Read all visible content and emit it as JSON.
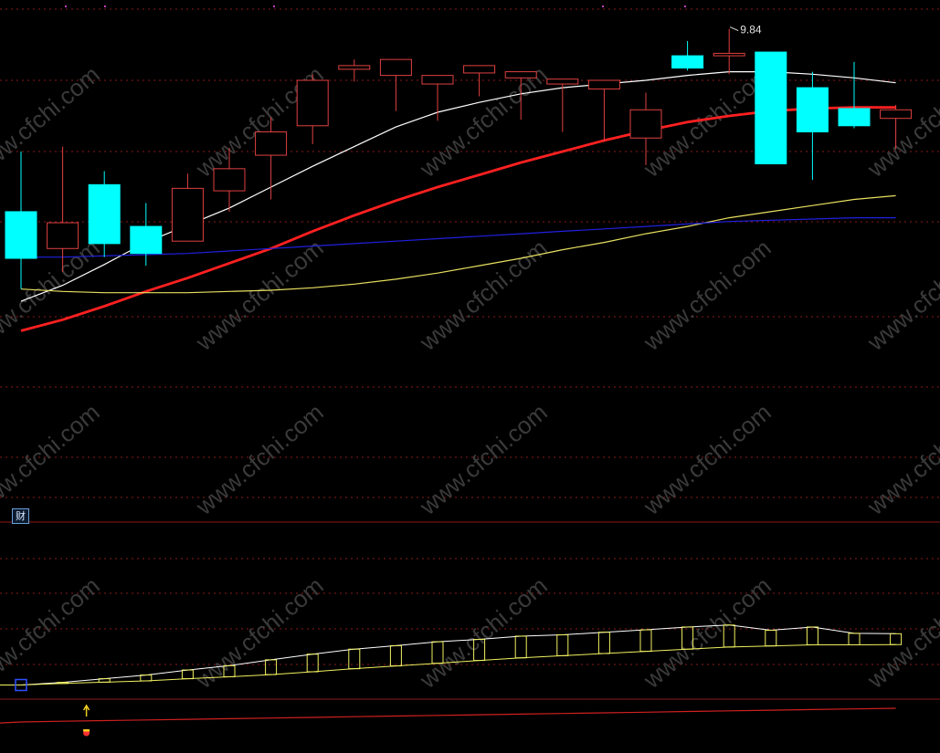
{
  "colors": {
    "background": "#000000",
    "up_candle": "#e04040",
    "down_candle": "#00ffff",
    "ma_white": "#ffffff",
    "ma_red": "#ff2020",
    "ma_yellow": "#e8e060",
    "ma_blue": "#2020e0",
    "grid": "#8b1a1a",
    "indicator_line": "#f0f060",
    "indicator_base": "#d02020"
  },
  "indicator_panel": {
    "badge_label": "财",
    "arrow_icon": "up-arrow-icon"
  },
  "chart_data": [
    {
      "type": "candlestick",
      "title": "",
      "xlabel": "",
      "ylabel": "",
      "annotations": [
        {
          "text": "9.84",
          "bar_index": 17
        }
      ],
      "grid": true,
      "ylim": [
        6.0,
        10.0
      ],
      "candles": [
        {
          "open": 8.35,
          "high": 8.84,
          "low": 7.72,
          "close": 7.97
        },
        {
          "open": 8.05,
          "high": 8.88,
          "low": 7.86,
          "close": 8.26
        },
        {
          "open": 8.57,
          "high": 8.68,
          "low": 7.98,
          "close": 8.09
        },
        {
          "open": 8.23,
          "high": 8.42,
          "low": 7.91,
          "close": 8.01
        },
        {
          "open": 8.11,
          "high": 8.66,
          "low": 8.11,
          "close": 8.54
        },
        {
          "open": 8.52,
          "high": 8.87,
          "low": 8.35,
          "close": 8.7
        },
        {
          "open": 8.81,
          "high": 9.12,
          "low": 8.45,
          "close": 9.0
        },
        {
          "open": 9.05,
          "high": 9.47,
          "low": 8.9,
          "close": 9.42
        },
        {
          "open": 9.51,
          "high": 9.59,
          "low": 9.41,
          "close": 9.54
        },
        {
          "open": 9.46,
          "high": 9.34,
          "low": 9.17,
          "close": 9.59
        },
        {
          "open": 9.39,
          "high": 9.23,
          "low": 9.09,
          "close": 9.46
        },
        {
          "open": 9.48,
          "high": 9.36,
          "low": 9.29,
          "close": 9.54
        },
        {
          "open": 9.44,
          "high": 9.21,
          "low": 9.1,
          "close": 9.49
        },
        {
          "open": 9.39,
          "high": 9.28,
          "low": 9.0,
          "close": 9.43
        },
        {
          "open": 9.35,
          "high": 9.04,
          "low": 8.92,
          "close": 9.42
        },
        {
          "open": 8.95,
          "high": 9.32,
          "low": 8.73,
          "close": 9.18
        },
        {
          "open": 9.62,
          "high": 9.74,
          "low": 9.5,
          "close": 9.52
        },
        {
          "open": 9.62,
          "high": 9.84,
          "low": 9.47,
          "close": 9.64
        },
        {
          "open": 9.65,
          "high": 9.65,
          "low": 8.83,
          "close": 8.74
        },
        {
          "open": 9.36,
          "high": 9.49,
          "low": 8.61,
          "close": 9.0
        },
        {
          "open": 9.19,
          "high": 9.57,
          "low": 9.03,
          "close": 9.05
        },
        {
          "open": 9.11,
          "high": 9.22,
          "low": 8.86,
          "close": 9.18
        }
      ],
      "series": [
        {
          "values": [
            7.62,
            7.75,
            7.92,
            8.1,
            8.24,
            8.38,
            8.55,
            8.72,
            8.88,
            9.04,
            9.16,
            9.24,
            9.31,
            9.36,
            9.39,
            9.42,
            9.46,
            9.49,
            9.49,
            9.47,
            9.44,
            9.4
          ]
        },
        {
          "values": [
            7.38,
            7.47,
            7.58,
            7.7,
            7.81,
            7.93,
            8.05,
            8.19,
            8.32,
            8.44,
            8.55,
            8.65,
            8.75,
            8.84,
            8.93,
            9.01,
            9.08,
            9.13,
            9.17,
            9.19,
            9.2,
            9.2
          ]
        },
        {
          "values": [
            7.72,
            7.7,
            7.69,
            7.69,
            7.69,
            7.7,
            7.71,
            7.73,
            7.76,
            7.8,
            7.85,
            7.91,
            7.97,
            8.04,
            8.1,
            8.17,
            8.23,
            8.3,
            8.35,
            8.4,
            8.45,
            8.48
          ]
        },
        {
          "values": [
            7.98,
            7.98,
            7.99,
            8.0,
            8.01,
            8.03,
            8.05,
            8.07,
            8.09,
            8.11,
            8.13,
            8.15,
            8.17,
            8.19,
            8.21,
            8.23,
            8.25,
            8.27,
            8.28,
            8.29,
            8.3,
            8.3
          ]
        }
      ]
    },
    {
      "type": "area",
      "title": "",
      "xlabel": "",
      "ylabel": "",
      "grid": true,
      "ylim": [
        0,
        100
      ],
      "marker_bar_index": 1,
      "series": [
        {
          "values": [
            25.0,
            26.2,
            27.9,
            29.6,
            31.9,
            33.9,
            36.6,
            39.2,
            41.5,
            43.1,
            44.9,
            46.0,
            47.5,
            48.1,
            49.3,
            50.4,
            51.7,
            52.6,
            50.2,
            51.7,
            48.8,
            48.6
          ]
        },
        {
          "values": [
            25.0,
            25.7,
            26.3,
            26.9,
            27.9,
            28.8,
            29.8,
            31.1,
            32.5,
            33.8,
            35.0,
            36.3,
            37.5,
            38.5,
            39.5,
            40.5,
            41.5,
            42.5,
            43.0,
            43.5,
            43.5,
            43.6
          ]
        },
        {
          "values": [
            8.0,
            8.3,
            8.6,
            8.9,
            9.2,
            9.5,
            9.8,
            10.1,
            10.4,
            10.7,
            11.0,
            11.3,
            11.6,
            11.9,
            12.2,
            12.5,
            12.8,
            13.1,
            13.4,
            13.7,
            14.0,
            14.3
          ]
        }
      ]
    }
  ]
}
